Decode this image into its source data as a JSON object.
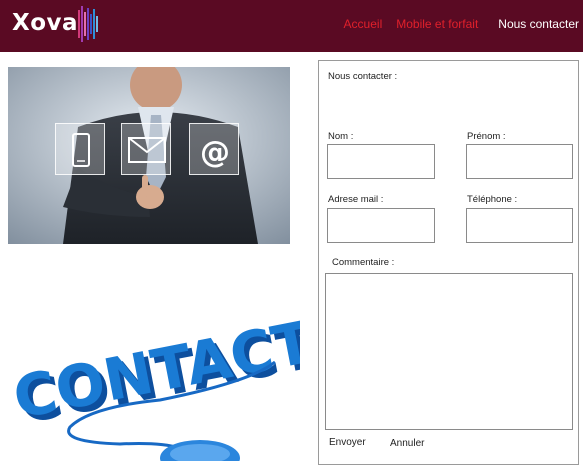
{
  "brand": {
    "name": "Xova",
    "accent": "#5a0a23"
  },
  "nav": {
    "accueil": "Accueil",
    "mobile": "Mobile et forfait",
    "contact": "Nous contacter",
    "active_color": "#e0202b"
  },
  "hero_image": {
    "icons": [
      "phone-icon",
      "mail-icon",
      "at-icon"
    ]
  },
  "contact_image": {
    "text": "CONTACT"
  },
  "form": {
    "heading": "Nous contacter :",
    "nom_label": "Nom :",
    "prenom_label": "Prénom :",
    "email_label": "Adrese mail :",
    "phone_label": "Téléphone :",
    "comment_label": "Commentaire :",
    "send": "Envoyer",
    "cancel": "Annuler"
  }
}
